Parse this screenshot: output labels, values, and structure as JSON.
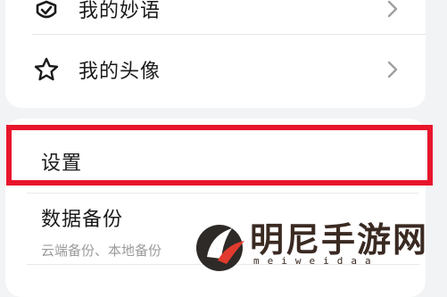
{
  "menu": {
    "items": [
      {
        "label": "我的妙语",
        "icon": "shield-check-icon"
      },
      {
        "label": "我的头像",
        "icon": "star-outline-icon"
      }
    ]
  },
  "settings": {
    "section_label": "设置",
    "highlight_color": "#e8152c"
  },
  "backup": {
    "title": "数据备份",
    "subtitle": "云端备份、本地备份"
  },
  "watermark": {
    "title": "明尼手游网",
    "url": "meiweidaa"
  }
}
